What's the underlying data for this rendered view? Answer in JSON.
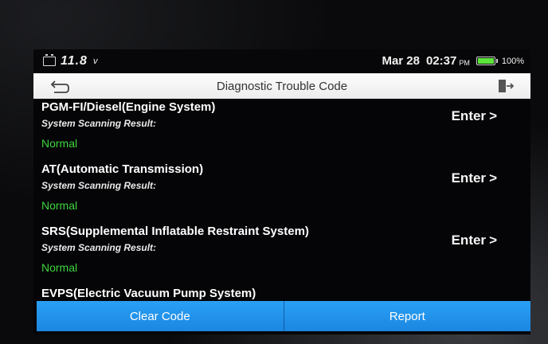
{
  "status": {
    "voltage": "11.8",
    "voltage_unit": "v",
    "date": "Mar 28",
    "time": "02:37",
    "ampm": "PM",
    "battery_percent": "100%",
    "battery_level": 1.0,
    "icons": {
      "car_battery": "car-battery-icon",
      "battery": "battery-icon"
    },
    "colors": {
      "battery_fill": "#5ce53a"
    }
  },
  "titlebar": {
    "title": "Diagnostic Trouble Code",
    "back_icon": "back-arrow-icon",
    "exit_icon": "exit-door-icon"
  },
  "systems": [
    {
      "name": "PGM-FI/Diesel(Engine System)",
      "subtitle": "System Scanning Result:",
      "result": "Normal",
      "action": "Enter"
    },
    {
      "name": "AT(Automatic Transmission)",
      "subtitle": "System Scanning Result:",
      "result": "Normal",
      "action": "Enter"
    },
    {
      "name": "SRS(Supplemental Inflatable Restraint System)",
      "subtitle": "System Scanning Result:",
      "result": "Normal",
      "action": "Enter"
    },
    {
      "name": "EVPS(Electric Vacuum Pump System)",
      "subtitle": "",
      "result": "",
      "action": ""
    }
  ],
  "bottom": {
    "clear_label": "Clear Code",
    "report_label": "Report"
  },
  "colors": {
    "accent": "#1b86e0",
    "normal_green": "#3fd53f"
  }
}
